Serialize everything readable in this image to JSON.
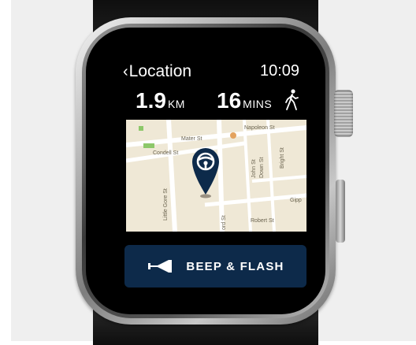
{
  "header": {
    "back_label": "Location",
    "time": "10:09"
  },
  "stats": {
    "distance_value": "1.9",
    "distance_unit": "KM",
    "time_value": "16",
    "time_unit": "MINS"
  },
  "map": {
    "streets": {
      "napoleon": "Napoleon St",
      "mater": "Mater St",
      "condell": "Condell St",
      "little_gore": "Little Gore St",
      "john": "John St",
      "down": "Down St",
      "bright": "Bright St",
      "gipps": "Gipp",
      "robert": "Robert St",
      "oxford": "ord St"
    },
    "pin_icon": "steering-wheel-icon"
  },
  "action": {
    "label": "BEEP & FLASH",
    "icon": "horn-icon"
  },
  "colors": {
    "button_bg": "#0d2a4a",
    "pin": "#0d2a4a",
    "map_bg": "#efe8d6"
  }
}
